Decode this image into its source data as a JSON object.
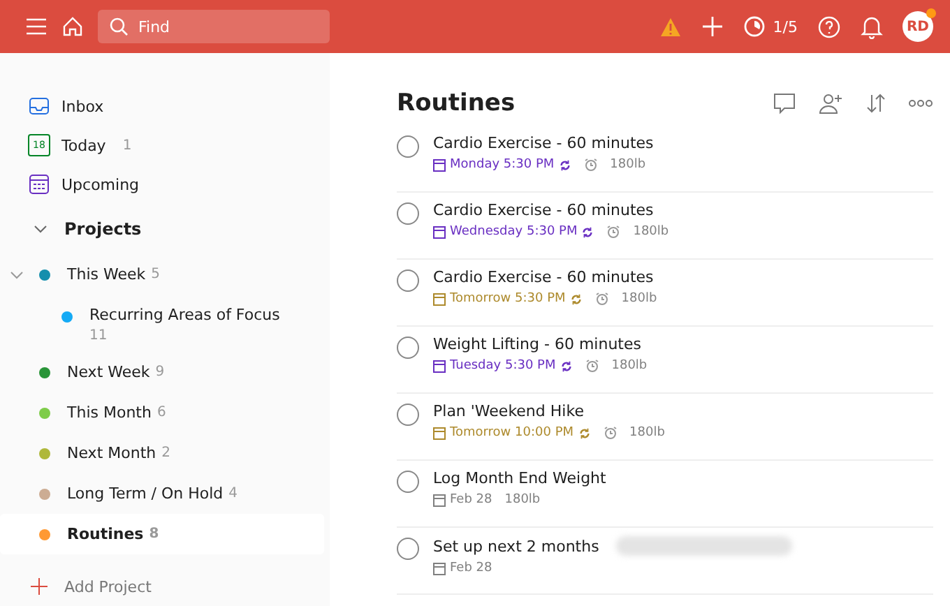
{
  "topbar": {
    "search": {
      "placeholder": "Find"
    },
    "karma": "1/5",
    "avatar": "RD",
    "avatar_notification": true
  },
  "sidebar": {
    "nav": [
      {
        "kind": "inbox",
        "label": "Inbox"
      },
      {
        "kind": "today",
        "label": "Today",
        "count": "1",
        "icon_text": "18"
      },
      {
        "kind": "upcoming",
        "label": "Upcoming"
      }
    ],
    "projects_header": {
      "label": "Projects",
      "expanded": true
    },
    "projects": [
      {
        "name": "This Week",
        "count": "5",
        "color": "#158fad",
        "selected": false,
        "expanded": true,
        "children": [
          {
            "name": "Recurring Areas of Focus",
            "count": "11",
            "color": "#14aaf5",
            "selected": false
          }
        ]
      },
      {
        "name": "Next Week",
        "count": "9",
        "color": "#299438",
        "selected": false
      },
      {
        "name": "This Month",
        "count": "6",
        "color": "#7ecc49",
        "selected": false
      },
      {
        "name": "Next Month",
        "count": "2",
        "color": "#afb83b",
        "selected": false
      },
      {
        "name": "Long Term / On Hold",
        "count": "4",
        "color": "#ccac93",
        "selected": false
      },
      {
        "name": "Routines",
        "count": "8",
        "color": "#ff9933",
        "selected": true
      }
    ],
    "add_project": "Add Project"
  },
  "main": {
    "title": "Routines",
    "tasks": [
      {
        "checked": false,
        "title": "Cardio Exercise - 60 minutes",
        "due": "Monday 5:30 PM",
        "color": "#692fc2",
        "recurring": true,
        "reminder": true,
        "label": "180lb",
        "redacted": false
      },
      {
        "checked": false,
        "title": "Cardio Exercise - 60 minutes",
        "due": "Wednesday 5:30 PM",
        "color": "#692fc2",
        "recurring": true,
        "reminder": true,
        "label": "180lb",
        "redacted": false
      },
      {
        "checked": false,
        "title": "Cardio Exercise - 60 minutes",
        "due": "Tomorrow 5:30 PM",
        "color": "#ad8a2c",
        "recurring": true,
        "reminder": true,
        "label": "180lb",
        "redacted": false
      },
      {
        "checked": false,
        "title": "Weight Lifting - 60 minutes",
        "due": "Tuesday 5:30 PM",
        "color": "#692fc2",
        "recurring": true,
        "reminder": true,
        "label": "180lb",
        "redacted": false
      },
      {
        "checked": false,
        "title": "Plan 'Weekend Hike",
        "due": "Tomorrow 10:00 PM",
        "color": "#ad8a2c",
        "recurring": true,
        "reminder": true,
        "label": "180lb",
        "redacted": false
      },
      {
        "checked": false,
        "title": "Log Month End Weight",
        "due": "Feb 28",
        "color": "#808080",
        "recurring": false,
        "reminder": false,
        "label": "180lb",
        "redacted": false
      },
      {
        "checked": false,
        "title": "Set up next 2 months",
        "due": "Feb 28",
        "color": "#808080",
        "recurring": false,
        "reminder": false,
        "redacted": true
      }
    ]
  }
}
